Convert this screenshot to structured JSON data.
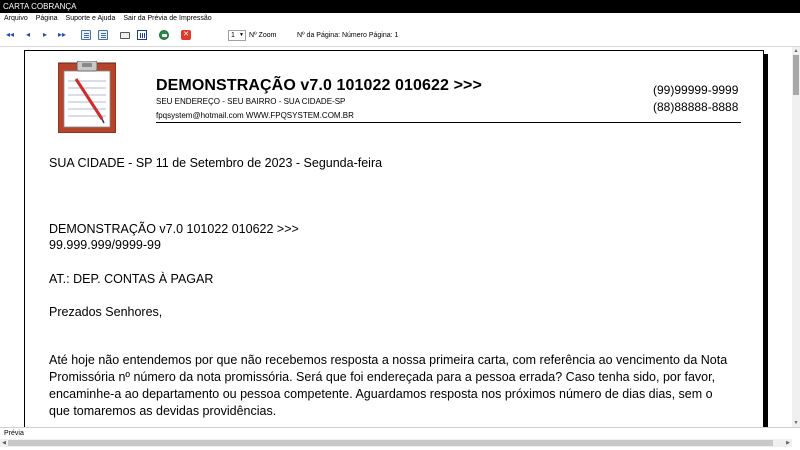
{
  "window": {
    "title": "CARTA COBRANÇA"
  },
  "menu": {
    "items": [
      {
        "label": "Arquivo"
      },
      {
        "label": "Página"
      },
      {
        "label": "Suporte e Ajuda"
      },
      {
        "label": "Sair da Prévia de Impressão"
      }
    ]
  },
  "toolbar": {
    "first_icon": "◂◂",
    "prev_icon": "◂",
    "next_icon": "▸",
    "last_icon": "▸▸",
    "exit_icon": "✕",
    "page_value": "1",
    "page_arrow": "▼",
    "zoom_label": "Nº Zoom",
    "page_info": "Nº da Página: Número Página: 1"
  },
  "document": {
    "company_name": "DEMONSTRAÇÃO v7.0 101022 010622 >>>",
    "address": "SEU ENDEREÇO - SEU BAIRRO - SUA CIDADE-SP",
    "email_site": "fpqsystem@hotmail.com  WWW.FPQSYSTEM.COM.BR",
    "phone1": "(99)99999-9999",
    "phone2": "(88)88888-8888",
    "date_line": "SUA CIDADE - SP 11 de Setembro de 2023 - Segunda-feira",
    "recipient_name": "DEMONSTRAÇÃO v7.0 101022 010622 >>>",
    "recipient_doc": "99.999.999/9999-99",
    "attention": "AT.: DEP. CONTAS À PAGAR",
    "greeting": "Prezados Senhores,",
    "body": "Até hoje não entendemos por que não recebemos resposta a nossa primeira carta, com referência ao vencimento da Nota Promissória nº número da nota promissória. Será que foi endereçada para a pessoa errada? Caso tenha sido, por favor, encaminhe-a ao departamento ou pessoa competente. Aguardamos resposta nos próximos número de dias dias, sem o que tomaremos as devidas providências."
  },
  "status": {
    "text": "Prévia"
  },
  "scroll": {
    "up": "▲",
    "down": "▼",
    "left": "◀",
    "right": "▶"
  },
  "colors": {
    "titlebar": "#000000",
    "toolbar_icon": "#1c4fb5",
    "logo_board": "#b5452a"
  }
}
